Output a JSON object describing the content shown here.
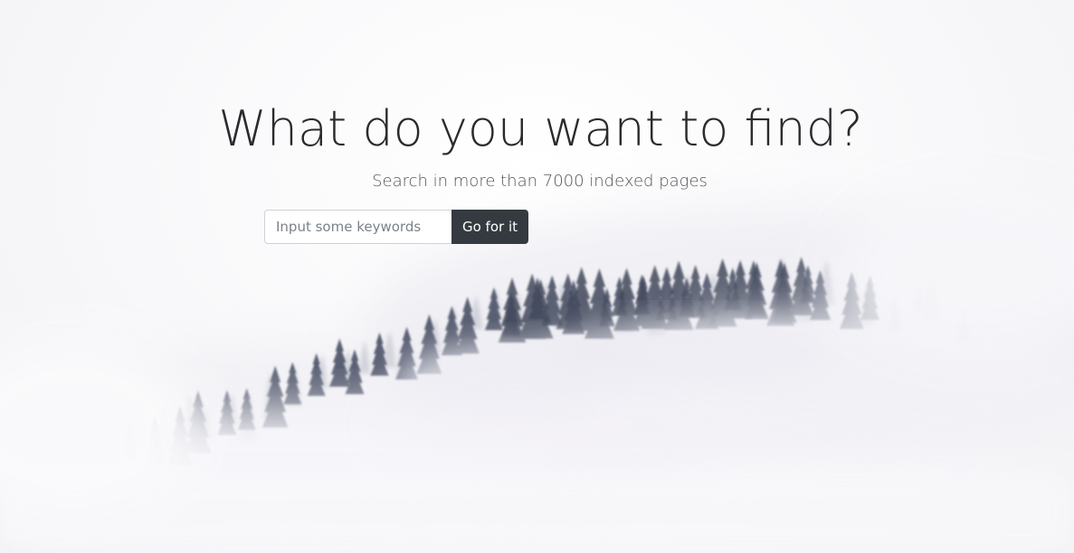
{
  "hero": {
    "title": "What do you want to find?",
    "subtitle": "Search in more than 7000 indexed pages"
  },
  "search": {
    "placeholder": "Input some keywords",
    "value": "",
    "button_label": "Go for it"
  },
  "colors": {
    "button_bg": "#343a40",
    "title_text": "#2b2b2e",
    "forest": "#4c5466",
    "fog": "#f6f5f9"
  },
  "background": {
    "icon": "foggy-forest-image"
  }
}
